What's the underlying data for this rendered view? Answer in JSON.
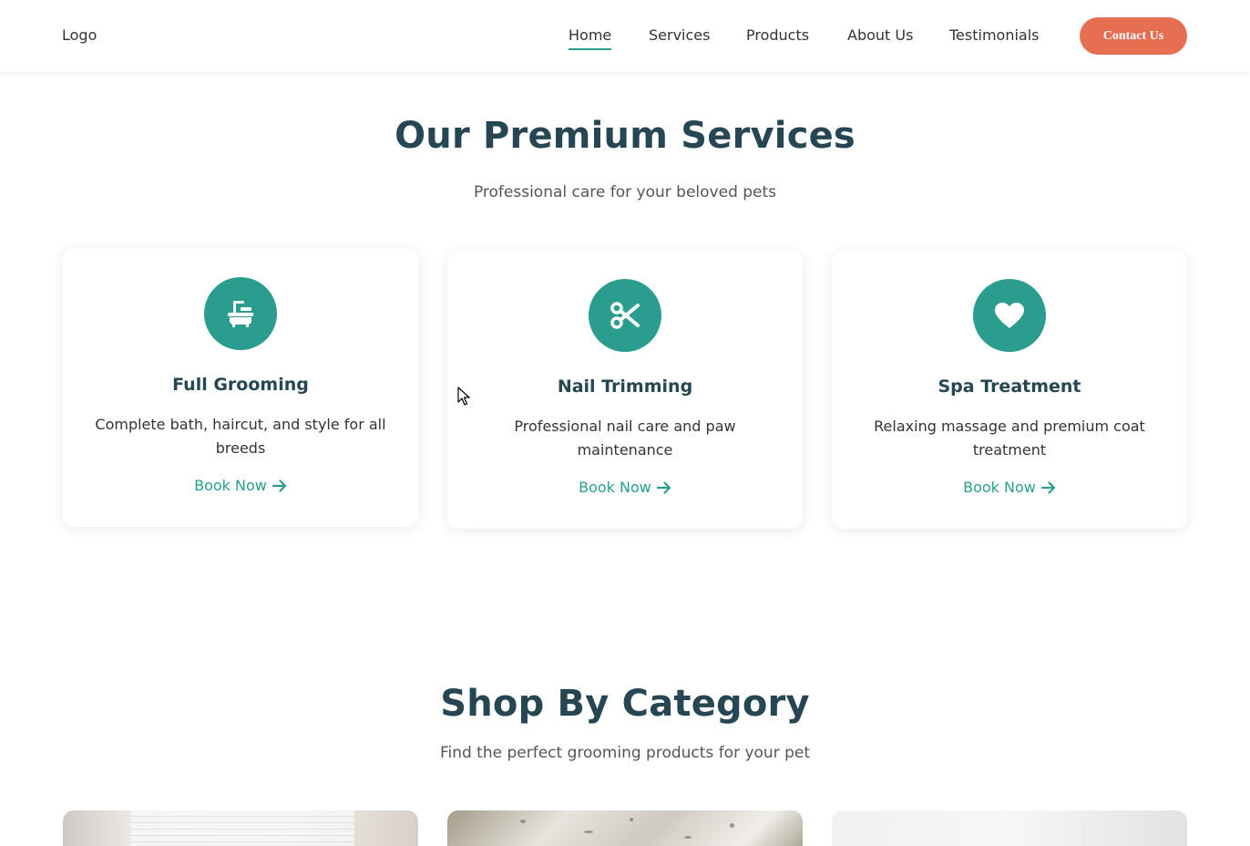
{
  "header": {
    "logo": "Logo",
    "nav": [
      {
        "label": "Home",
        "active": true
      },
      {
        "label": "Services",
        "active": false
      },
      {
        "label": "Products",
        "active": false
      },
      {
        "label": "About Us",
        "active": false
      },
      {
        "label": "Testimonials",
        "active": false
      }
    ],
    "contact_label": "Contact Us"
  },
  "services": {
    "title": "Our Premium Services",
    "subtitle": "Professional care for your beloved pets",
    "cards": [
      {
        "icon": "bathtub-icon",
        "title": "Full Grooming",
        "description": "Complete bath, haircut, and style for all breeds",
        "link": "Book Now"
      },
      {
        "icon": "scissors-icon",
        "title": "Nail Trimming",
        "description": "Professional nail care and paw maintenance",
        "link": "Book Now"
      },
      {
        "icon": "heart-icon",
        "title": "Spa Treatment",
        "description": "Relaxing massage and premium coat treatment",
        "link": "Book Now"
      }
    ]
  },
  "categories": {
    "title": "Shop By Category",
    "subtitle": "Find the perfect grooming products for your pet"
  },
  "colors": {
    "accent": "#2a9d8f",
    "cta": "#e76f51",
    "heading": "#264653"
  }
}
